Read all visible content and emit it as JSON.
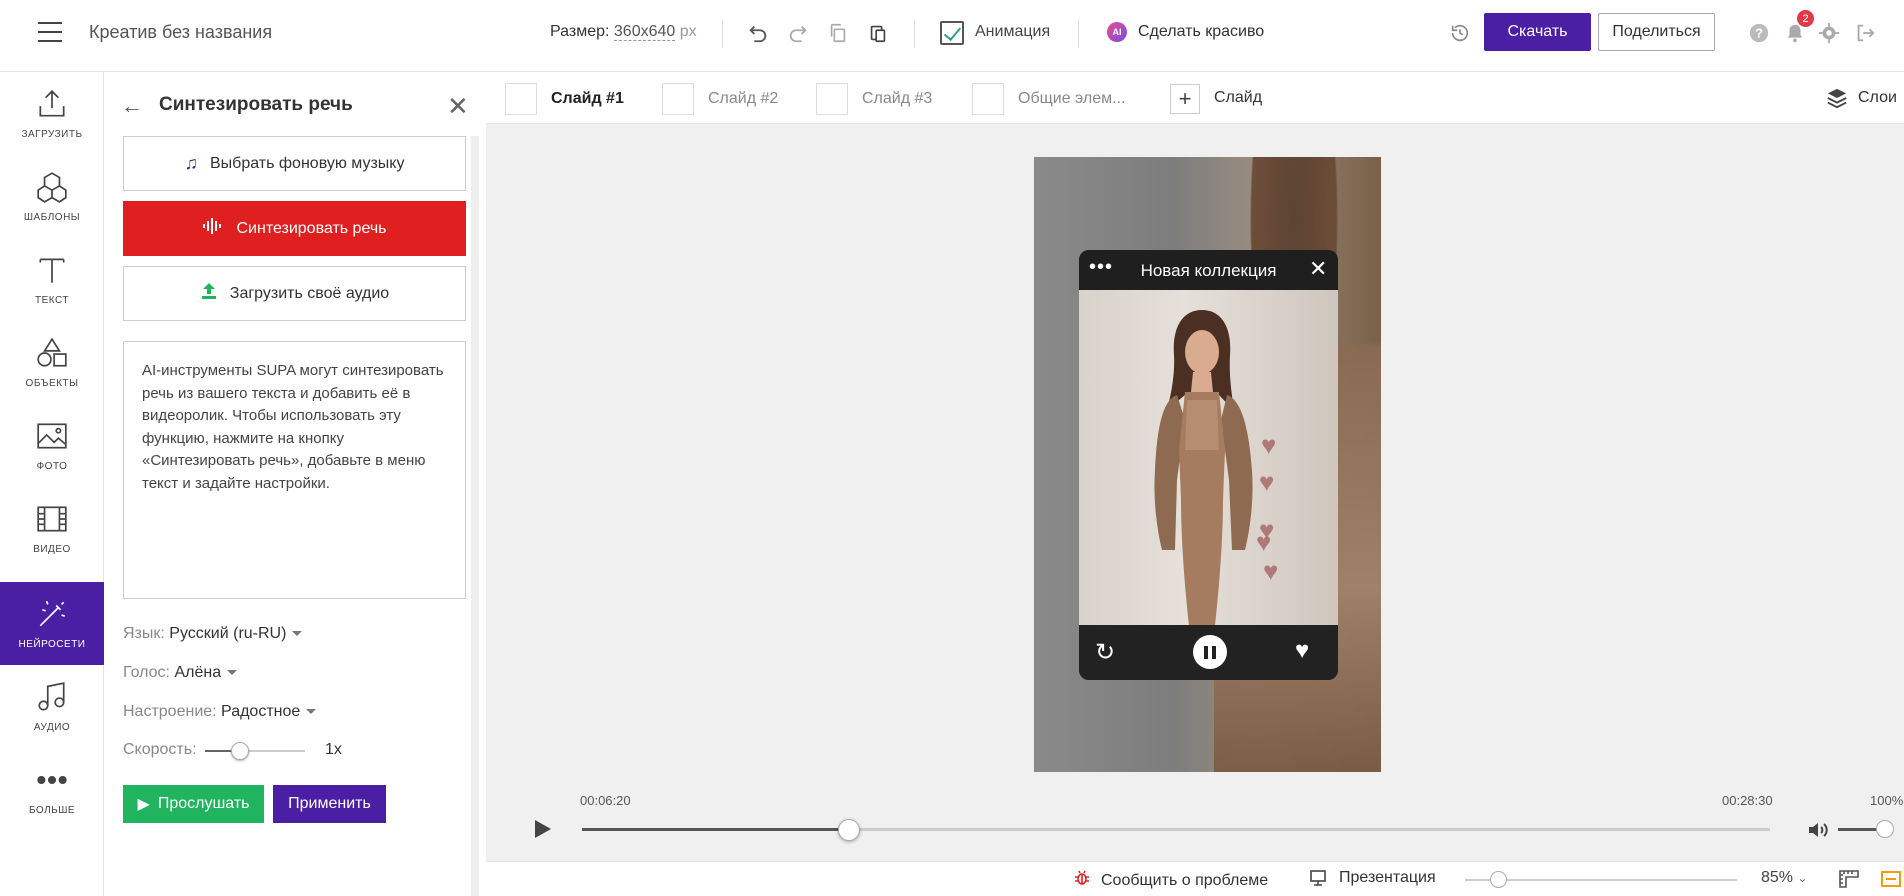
{
  "header": {
    "document_title": "Креатив без названия",
    "size_label": "Размер:",
    "size_value": "360x640",
    "size_unit": "px",
    "animation_label": "Анимация",
    "animation_checked": true,
    "ai_badge": "AI",
    "beautify_label": "Сделать красиво",
    "download_label": "Скачать",
    "share_label": "Поделиться",
    "notifications_count": "2",
    "accent_color": "#4b1fa3"
  },
  "leftnav": {
    "items": [
      {
        "label": "Загрузить",
        "icon": "upload-icon"
      },
      {
        "label": "Шаблоны",
        "icon": "templates-icon"
      },
      {
        "label": "Текст",
        "icon": "text-icon"
      },
      {
        "label": "Объекты",
        "icon": "objects-icon"
      },
      {
        "label": "Фото",
        "icon": "photo-icon"
      },
      {
        "label": "Видео",
        "icon": "video-icon"
      },
      {
        "label": "Нейросети",
        "icon": "magic-wand-icon",
        "active": true
      },
      {
        "label": "Аудио",
        "icon": "music-icon"
      },
      {
        "label": "Больше",
        "icon": "more-icon"
      }
    ]
  },
  "panel": {
    "title": "Синтезировать речь",
    "btn_music": "Выбрать фоновую музыку",
    "btn_synth": "Синтезировать речь",
    "btn_upload": "Загрузить своё аудио",
    "text": "AI-инструменты SUPA могут синтезировать речь из вашего текста и добавить её в видеоролик. Чтобы использовать эту функцию, нажмите на кнопку «Синтезировать речь», добавьте в меню текст и задайте настройки.",
    "language_label": "Язык:",
    "language_value": "Русский (ru-RU)",
    "voice_label": "Голос:",
    "voice_value": "Алёна",
    "mood_label": "Настроение:",
    "mood_value": "Радостное",
    "speed_label": "Скорость:",
    "speed_value": "1x",
    "speed_fraction": 0.35,
    "btn_listen": "Прослушать",
    "btn_apply": "Применить"
  },
  "slides": {
    "tabs": [
      {
        "label": "Слайд #1",
        "active": true
      },
      {
        "label": "Слайд #2",
        "active": false
      },
      {
        "label": "Слайд #3",
        "active": false
      },
      {
        "label": "Общие элем...",
        "active": false
      }
    ],
    "add_label": "Слайд",
    "layers_label": "Слои"
  },
  "player": {
    "title": "Новая коллекция"
  },
  "timeline": {
    "current_time": "00:06:20",
    "total_time": "00:28:30",
    "progress_fraction": 0.225,
    "volume_pct": "100%",
    "volume_fraction": 1.0
  },
  "bottombar": {
    "report_label": "Сообщить о проблеме",
    "presentation_label": "Презентация",
    "zoom_value": "85%",
    "zoom_fraction": 0.12
  }
}
